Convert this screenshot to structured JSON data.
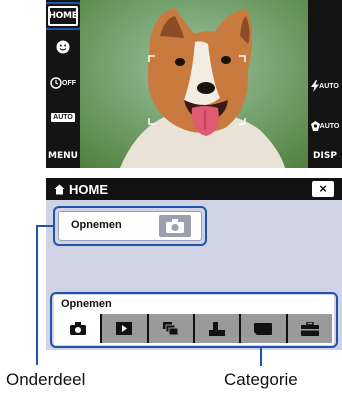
{
  "camera": {
    "home_label": "HOME",
    "left_icons": [
      "smile-face-icon",
      "flash-off-self-timer-icon",
      "scene-auto-icon"
    ],
    "left_texts": {
      "self_timer": "OFF",
      "scene": "AUTO",
      "menu": "MENU"
    },
    "right_texts": {
      "flash": "AUTO",
      "red_eye": "AUTO",
      "disp": "DISP"
    }
  },
  "panel": {
    "title": "HOME",
    "close_symbol": "×",
    "selected_item": "Opnemen",
    "category_label": "Opnemen",
    "category_tabs": [
      "camera-icon",
      "play-icon",
      "slideshow-icon",
      "print-icon",
      "memory-card-icon",
      "toolbox-icon"
    ]
  },
  "callouts": {
    "item": "Onderdeel",
    "category": "Categorie"
  },
  "colors": {
    "highlight": "#1f55a8",
    "panel_bg": "#cfd3e3",
    "bar_bg": "#111111"
  }
}
